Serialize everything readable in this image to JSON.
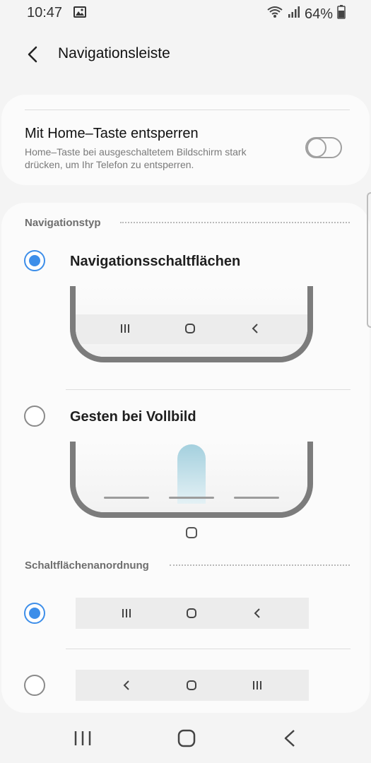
{
  "status_bar": {
    "time": "10:47",
    "battery": "64%"
  },
  "app_bar": {
    "title": "Navigationsleiste"
  },
  "home_button_unlock": {
    "title": "Mit Home–Taste entsperren",
    "description": "Home–Taste bei ausgeschaltetem Bildschirm stark drücken, um Ihr Telefon zu entsperren.",
    "enabled": false
  },
  "navigation_type": {
    "header": "Navigationstyp",
    "options": [
      {
        "label": "Navigationsschaltflächen",
        "selected": true
      },
      {
        "label": "Gesten bei Vollbild",
        "selected": false
      }
    ]
  },
  "button_order": {
    "header": "Schaltflächenanordnung",
    "options": [
      {
        "icons": [
          "recents-icon",
          "home-icon",
          "back-icon"
        ],
        "selected": true
      },
      {
        "icons": [
          "back-icon",
          "home-icon",
          "recents-icon"
        ],
        "selected": false
      }
    ]
  },
  "colors": {
    "accent": "#3d8ee9",
    "background": "#f4f4f4",
    "card": "#fbfbfb",
    "gesture_highlight": "#a4d0de"
  }
}
